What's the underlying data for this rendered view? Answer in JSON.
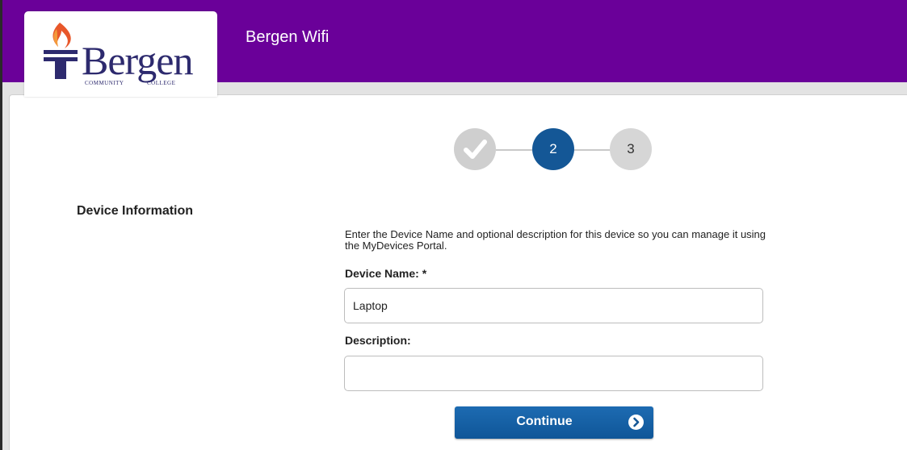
{
  "header": {
    "app_title": "Bergen Wifi",
    "background_color": "#6a0099"
  },
  "logo": {
    "wordmark": "Bergen",
    "sub_left": "COMMUNITY",
    "sub_right": "COLLEGE",
    "icon": "torch-icon"
  },
  "progress": {
    "steps": [
      {
        "label": "",
        "state": "complete",
        "icon": "checkmark-icon"
      },
      {
        "label": "2",
        "state": "current"
      },
      {
        "label": "3",
        "state": "upcoming"
      }
    ],
    "current_step": 2
  },
  "form": {
    "section_title": "Device Information",
    "instructions": "Enter the Device Name and optional description for this device so you can manage it using the MyDevices Portal.",
    "device_name_label": "Device Name: *",
    "device_name_value": "Laptop",
    "description_label": "Description:",
    "description_value": "",
    "continue_label": "Continue",
    "continue_icon": "chevron-right-icon"
  },
  "colors": {
    "accent": "#145796",
    "purple": "#6a0099"
  }
}
